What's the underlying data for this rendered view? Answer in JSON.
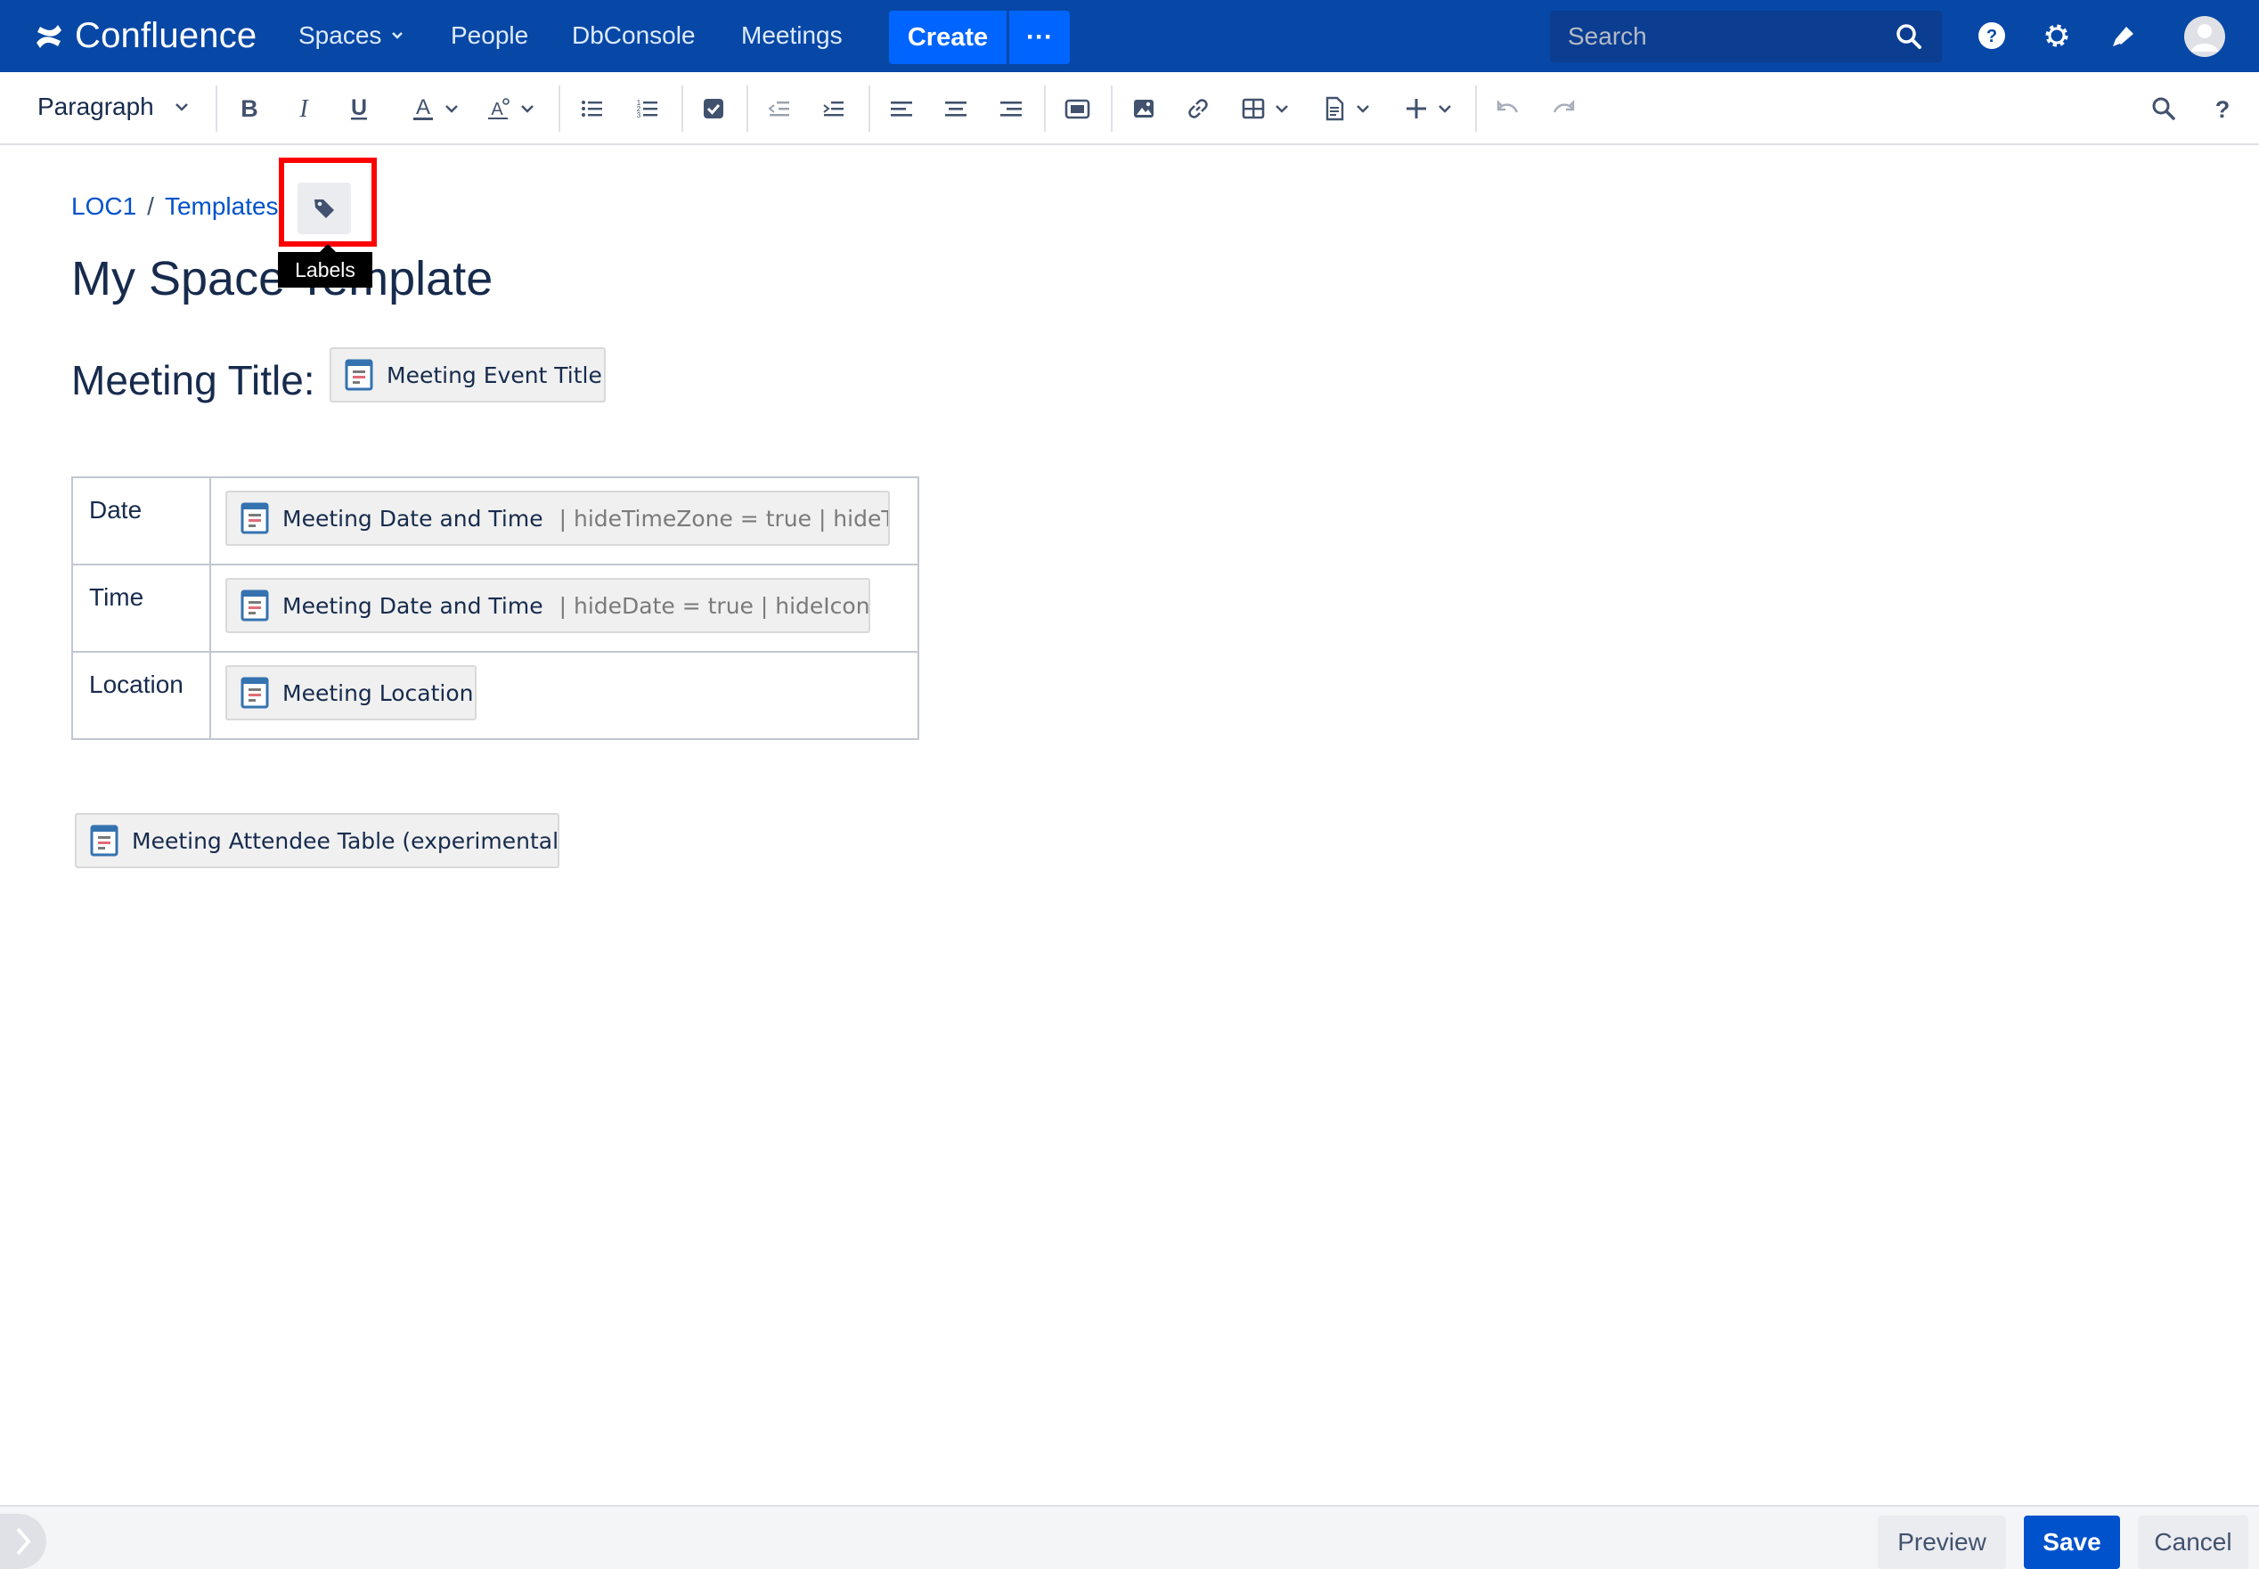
{
  "app": {
    "name": "Confluence"
  },
  "nav": {
    "spaces": "Spaces",
    "people": "People",
    "dbconsole": "DbConsole",
    "meetings": "Meetings",
    "create": "Create",
    "more": "···",
    "search_placeholder": "Search"
  },
  "toolbar": {
    "paragraph": "Paragraph"
  },
  "breadcrumb": {
    "space": "LOC1",
    "separator": "/",
    "page": "Templates"
  },
  "labels_tooltip": "Labels",
  "page_title": "My Space Template",
  "content": {
    "meeting_title_label": "Meeting Title:",
    "meeting_title_macro": "Meeting Event Title",
    "table": [
      {
        "key": "Date",
        "macro": "Meeting Date and Time",
        "params": "| hideTimeZone = true | hideT..."
      },
      {
        "key": "Time",
        "macro": "Meeting Date and Time",
        "params": "| hideDate = true | hideIcon ..."
      },
      {
        "key": "Location",
        "macro": "Meeting Location",
        "params": ""
      }
    ],
    "attendee_macro": "Meeting Attendee Table (experimental)"
  },
  "footer": {
    "preview": "Preview",
    "save": "Save",
    "cancel": "Cancel"
  },
  "colors": {
    "nav_bg": "#0747A6",
    "create_bg": "#0065FF",
    "link": "#0052CC",
    "highlight": "#FF0000"
  }
}
